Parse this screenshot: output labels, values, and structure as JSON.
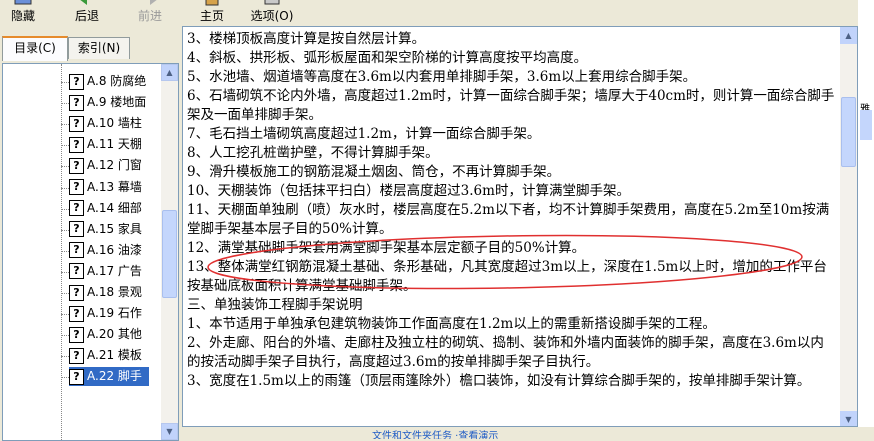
{
  "toolbar": {
    "buttons": [
      {
        "name": "hide-button",
        "label": "隐藏",
        "icon": "hide-icon"
      },
      {
        "name": "back-button",
        "label": "后退",
        "icon": "back-arrow-icon"
      },
      {
        "name": "forward-button",
        "label": "前进",
        "icon": "forward-arrow-icon",
        "disabled": true
      },
      {
        "name": "home-button",
        "label": "主页",
        "icon": "home-icon"
      },
      {
        "name": "options-button",
        "label": "选项(O)",
        "icon": "options-icon"
      }
    ]
  },
  "tabs": {
    "contents": "目录(C)",
    "index": "索引(N)"
  },
  "tree": {
    "items": [
      {
        "label": "A.8  防腐绝"
      },
      {
        "label": "A.9  楼地面"
      },
      {
        "label": "A.10  墙柱"
      },
      {
        "label": "A.11  天棚"
      },
      {
        "label": "A.12  门窗"
      },
      {
        "label": "A.13  幕墙"
      },
      {
        "label": "A.14  细部"
      },
      {
        "label": "A.15  家具"
      },
      {
        "label": "A.16  油漆"
      },
      {
        "label": "A.17  广告"
      },
      {
        "label": "A.18 景观"
      },
      {
        "label": "A.19 石作"
      },
      {
        "label": "A.20  其他"
      },
      {
        "label": "A.21  模板"
      },
      {
        "label": "A.22  脚手"
      }
    ],
    "selected_index": 14
  },
  "content": {
    "paragraphs": [
      "    3、楼梯顶板高度计算是按自然层计算。",
      "    4、斜板、拱形板、弧形板屋面和架空阶梯的计算高度按平均高度。",
      "    5、水池墙、烟道墙等高度在3.6m以内套用单排脚手架，3.6m以上套用综合脚手架。",
      "    6、石墙砌筑不论内外墙，高度超过1.2m时，计算一面综合脚手架；墙厚大于40cm时，则计算一面综合脚手架及一面单排脚手架。",
      "    7、毛石挡土墙砌筑高度超过1.2m，计算一面综合脚手架。",
      "    8、人工挖孔桩凿护壁，不得计算脚手架。",
      "    9、滑升模板施工的钢筋混凝土烟囱、筒仓，不再计算脚手架。",
      "    10、天棚装饰（包括抹平扫白）楼层高度超过3.6m时，计算满堂脚手架。",
      "    11、天棚面单独刷（喷）灰水时，楼层高度在5.2m以下者，均不计算脚手架费用，高度在5.2m至10m按满堂脚手架基本层子目的50%计算。",
      "    12、满堂基础脚手架套用满堂脚手架基本层定额子目的50%计算。",
      "    13、整体满堂红钢筋混凝土基础、条形基础，凡其宽度超过3m以上，深度在1.5m以上时，增加的工作平台按基础底板面积计算满堂基础脚手架。",
      "    三、单独装饰工程脚手架说明",
      "    1、本节适用于单独承包建筑物装饰工作面高度在1.2m以上的需重新搭设脚手架的工程。",
      "    2、外走廊、阳台的外墙、走廊柱及独立柱的砌筑、捣制、装饰和外墙内面装饰的脚手架，高度在3.6m以内的按活动脚手架子目执行，高度超过3.6m的按单排脚手架子目执行。",
      "    3、宽度在1.5m以上的雨篷（顶层雨篷除外）檐口装饰，如没有计算综合脚手架的，按单排脚手架计算。"
    ]
  },
  "background_fragments": {
    "bottom_text": "文件和文件夹任务          ·查看演示",
    "right_text": "雅"
  },
  "colors": {
    "selection": "#316ac5",
    "annotation_ellipse": "#e03030",
    "tab_accent": "#e68b2c"
  }
}
